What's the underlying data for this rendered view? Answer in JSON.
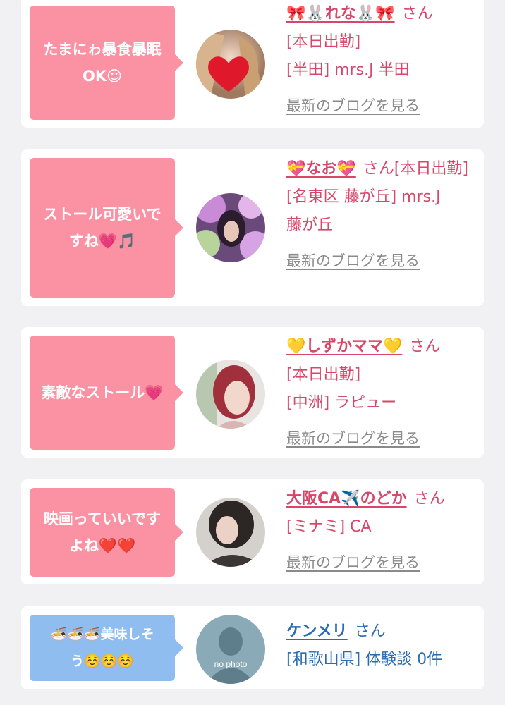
{
  "colors": {
    "pink_bubble": "#fb92a4",
    "blue_bubble": "#8fbdf0",
    "pink_text": "#d8466a",
    "blue_text": "#2a6bb4"
  },
  "cards": [
    {
      "comment_line1": "たまにゎ暴食暴眠",
      "comment_line2": "OK☺",
      "name": "🎀🐰れな🐰🎀",
      "san": "さん",
      "line1": "[本日出勤]",
      "line2": "[半田] mrs.J 半田",
      "blog_link": "最新のブログを見る",
      "avatar_icon": "heart-sticker-icon"
    },
    {
      "comment_line1": "ストール可愛いで",
      "comment_line2": "すね💗🎵",
      "name": "💝なお💝",
      "san": "さん[本日出勤]",
      "line1": "[名東区 藤が丘] mrs.J",
      "line2": "藤が丘",
      "blog_link": "最新のブログを見る",
      "avatar_icon": "purple-flower-photo"
    },
    {
      "comment_line1": "素敵なストール💗",
      "name": "💛しずかママ💛",
      "san": "さん",
      "line1": "[本日出勤]",
      "line2": "[中洲] ラピュー",
      "blog_link": "最新のブログを見る",
      "avatar_icon": "red-hair-photo"
    },
    {
      "comment_line1": "映画っていいです",
      "comment_line2": "よね❤️❤️",
      "name": "大阪CA✈️のどか",
      "san": "さん",
      "line1": "[ミナミ] CA",
      "blog_link": "最新のブログを見る",
      "avatar_icon": "dark-hair-photo"
    },
    {
      "comment_line1": "🍜🍜🍜美味しそ",
      "comment_line2": "う☺️☺️☺️",
      "name": "ケンメリ",
      "san": "さん",
      "line1": "[和歌山県] 体験談 0件",
      "avatar_text": "no photo",
      "avatar_icon": "silhouette-icon"
    }
  ]
}
